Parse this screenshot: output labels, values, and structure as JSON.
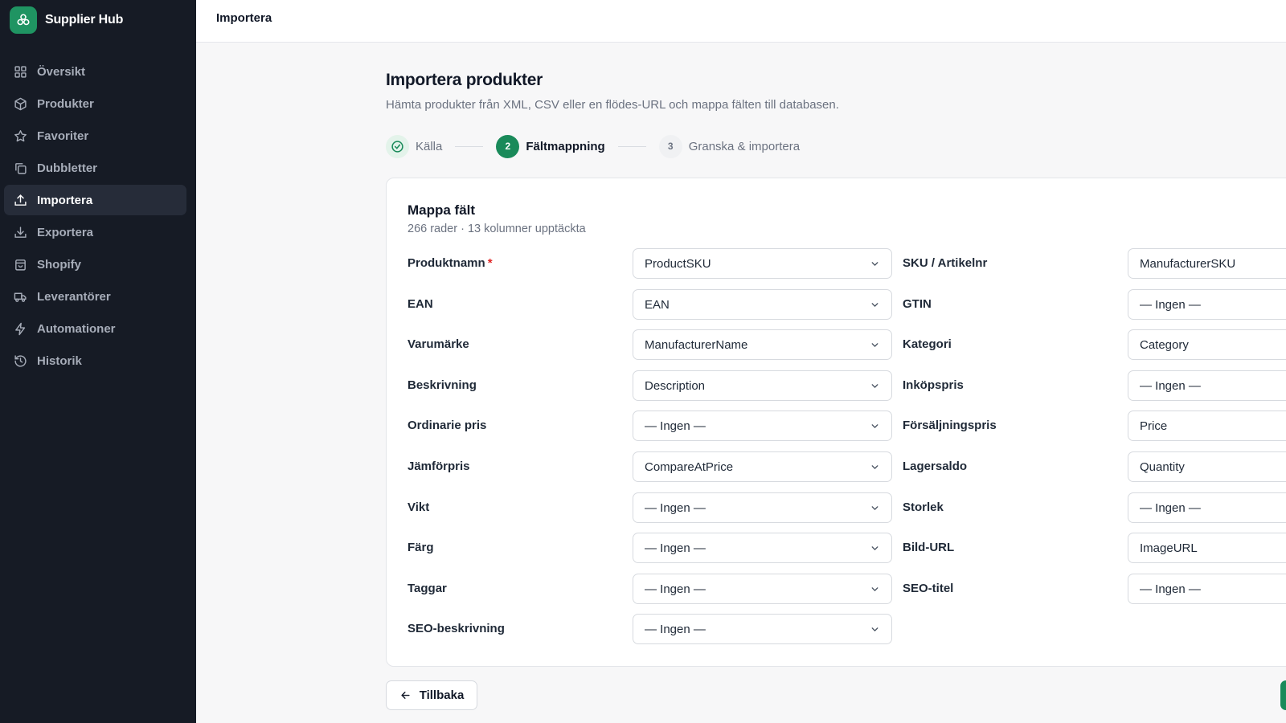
{
  "app": {
    "name": "Supplier Hub"
  },
  "sidebar": {
    "items": [
      {
        "label": "Översikt",
        "icon": "grid-icon",
        "active": false
      },
      {
        "label": "Produkter",
        "icon": "package-icon",
        "active": false
      },
      {
        "label": "Favoriter",
        "icon": "star-icon",
        "active": false
      },
      {
        "label": "Dubbletter",
        "icon": "copy-icon",
        "active": false
      },
      {
        "label": "Importera",
        "icon": "upload-icon",
        "active": true
      },
      {
        "label": "Exportera",
        "icon": "download-icon",
        "active": false
      },
      {
        "label": "Shopify",
        "icon": "shopping-bag-icon",
        "active": false
      },
      {
        "label": "Leverantörer",
        "icon": "truck-icon",
        "active": false
      },
      {
        "label": "Automationer",
        "icon": "zap-icon",
        "active": false
      },
      {
        "label": "Historik",
        "icon": "history-icon",
        "active": false
      }
    ]
  },
  "topbar": {
    "title": "Importera"
  },
  "page": {
    "title": "Importera produkter",
    "subtitle": "Hämta produkter från XML, CSV eller en flödes-URL och mappa fälten till databasen."
  },
  "stepper": {
    "steps": [
      {
        "number": "1",
        "label": "Källa",
        "state": "done"
      },
      {
        "number": "2",
        "label": "Fältmappning",
        "state": "current"
      },
      {
        "number": "3",
        "label": "Granska & importera",
        "state": "upcoming"
      }
    ]
  },
  "mapping": {
    "title": "Mappa fält",
    "summary": "266 rader · 13 kolumner upptäckta",
    "left": [
      {
        "label": "Produktnamn",
        "required": "*",
        "value": "ProductSKU"
      },
      {
        "label": "EAN",
        "value": "EAN"
      },
      {
        "label": "Varumärke",
        "value": "ManufacturerName"
      },
      {
        "label": "Beskrivning",
        "value": "Description"
      },
      {
        "label": "Ordinarie pris",
        "value": "— Ingen —"
      },
      {
        "label": "Jämförpris",
        "value": "CompareAtPrice"
      },
      {
        "label": "Vikt",
        "value": "— Ingen —"
      },
      {
        "label": "Färg",
        "value": "— Ingen —"
      },
      {
        "label": "Taggar",
        "value": "— Ingen —"
      },
      {
        "label": "SEO-beskrivning",
        "value": "— Ingen —"
      }
    ],
    "right": [
      {
        "label": "SKU / Artikelnr",
        "value": "ManufacturerSKU"
      },
      {
        "label": "GTIN",
        "value": "— Ingen —"
      },
      {
        "label": "Kategori",
        "value": "Category"
      },
      {
        "label": "Inköpspris",
        "value": "— Ingen —"
      },
      {
        "label": "Försäljningspris",
        "value": "Price"
      },
      {
        "label": "Lagersaldo",
        "value": "Quantity"
      },
      {
        "label": "Storlek",
        "value": "— Ingen —"
      },
      {
        "label": "Bild-URL",
        "value": "ImageURL"
      },
      {
        "label": "SEO-titel",
        "value": "— Ingen —"
      }
    ]
  },
  "footer": {
    "back_label": "Tillbaka"
  },
  "colors": {
    "accent": "#1a8a5a",
    "sidebar_bg": "#161b25",
    "required": "#e02424"
  }
}
